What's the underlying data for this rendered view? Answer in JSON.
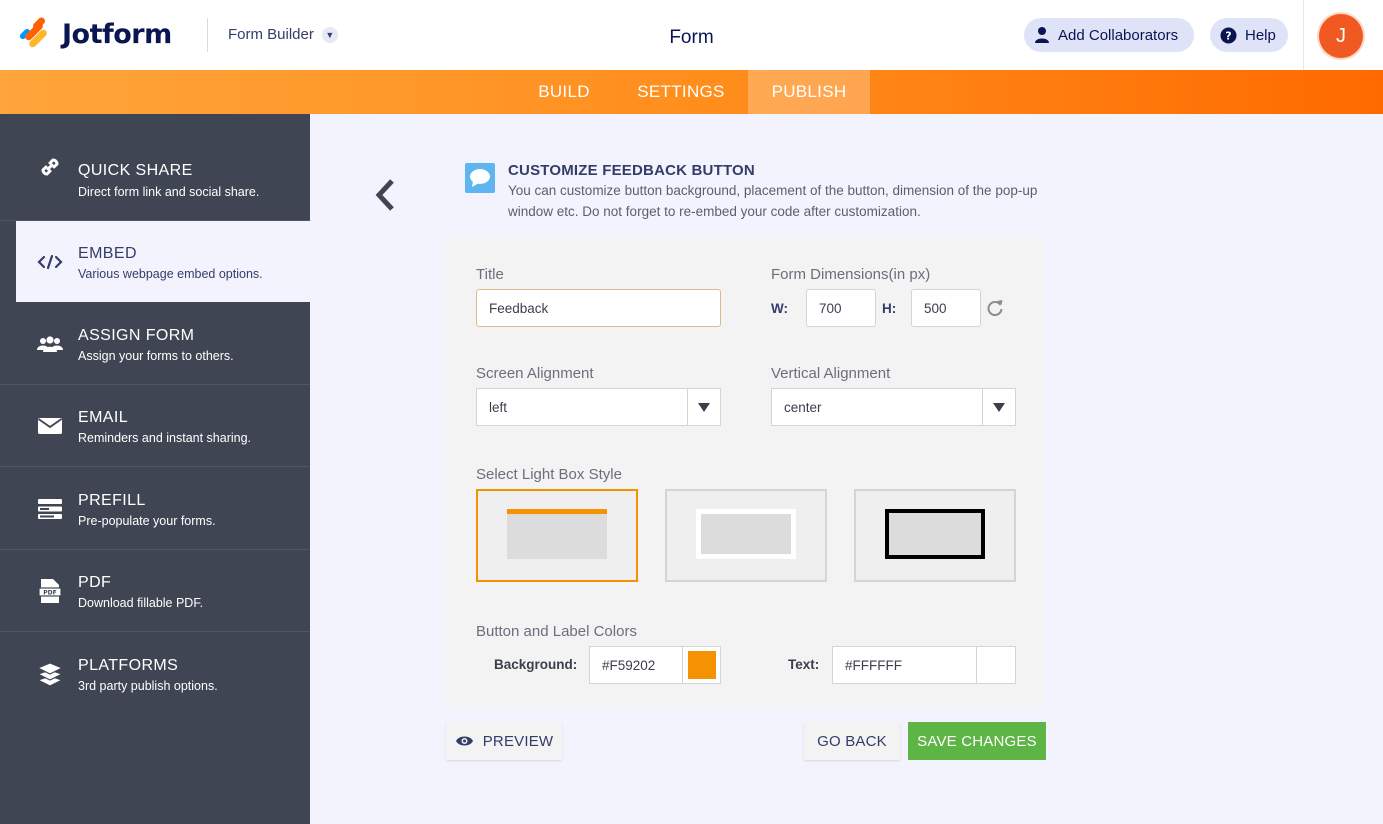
{
  "header": {
    "brand": "Jotform",
    "builder_label": "Form Builder",
    "form_title": "Form",
    "collaborators_label": "Add Collaborators",
    "help_label": "Help",
    "avatar_initial": "J"
  },
  "tabs": [
    {
      "label": "BUILD"
    },
    {
      "label": "SETTINGS"
    },
    {
      "label": "PUBLISH",
      "active": true
    }
  ],
  "sidebar": {
    "items": [
      {
        "title": "QUICK SHARE",
        "desc": "Direct form link and social share.",
        "icon": "link-icon"
      },
      {
        "title": "EMBED",
        "desc": "Various webpage embed options.",
        "icon": "code-icon",
        "active": true
      },
      {
        "title": "ASSIGN FORM",
        "desc": "Assign your forms to others.",
        "icon": "users-icon"
      },
      {
        "title": "EMAIL",
        "desc": "Reminders and instant sharing.",
        "icon": "envelope-icon"
      },
      {
        "title": "PREFILL",
        "desc": "Pre-populate your forms.",
        "icon": "prefill-icon"
      },
      {
        "title": "PDF",
        "desc": "Download fillable PDF.",
        "icon": "pdf-icon"
      },
      {
        "title": "PLATFORMS",
        "desc": "3rd party publish options.",
        "icon": "layers-icon"
      }
    ]
  },
  "panel": {
    "title": "CUSTOMIZE FEEDBACK BUTTON",
    "description": "You can customize button background, placement of the button, dimension of the pop-up window etc. Do not forget to re-embed your code after customization."
  },
  "form": {
    "title_label": "Title",
    "title_value": "Feedback",
    "dimensions_label": "Form Dimensions(in px)",
    "width_label": "W:",
    "width_value": "700",
    "height_label": "H:",
    "height_value": "500",
    "screen_alignment_label": "Screen Alignment",
    "screen_alignment_value": "left",
    "vertical_alignment_label": "Vertical Alignment",
    "vertical_alignment_value": "center",
    "lightbox_label": "Select Light Box Style",
    "lightbox_selected": 0,
    "colors_label": "Button and Label Colors",
    "background_label": "Background:",
    "background_value": "#F59202",
    "text_label": "Text:",
    "text_value": "#FFFFFF"
  },
  "buttons": {
    "preview": "PREVIEW",
    "go_back": "GO BACK",
    "save": "SAVE CHANGES"
  },
  "colors": {
    "accent": "#ff8c1a",
    "save_green": "#5cb545",
    "sidebar_bg": "#3f4552",
    "background_swatch": "#F59202",
    "text_swatch": "#FFFFFF"
  }
}
